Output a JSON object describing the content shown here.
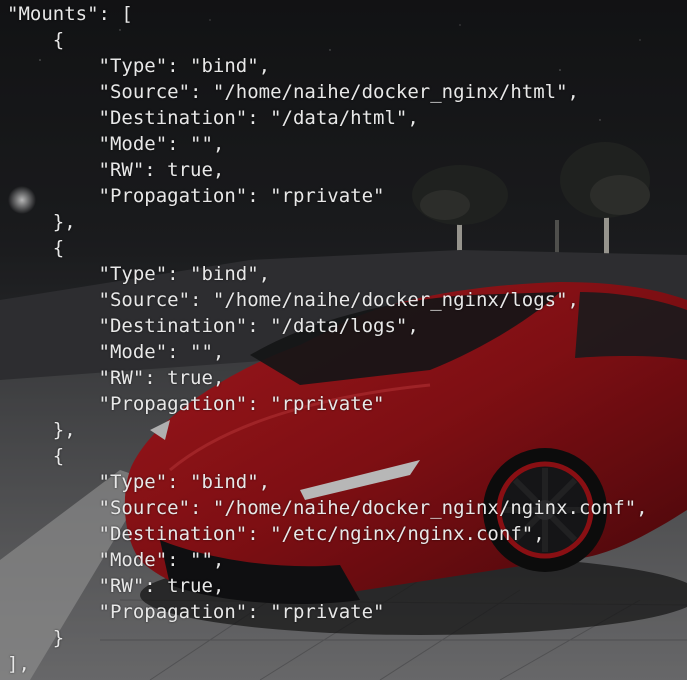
{
  "terminal": {
    "lines": [
      "\"Mounts\": [",
      "    {",
      "        \"Type\": \"bind\",",
      "        \"Source\": \"/home/naihe/docker_nginx/html\",",
      "        \"Destination\": \"/data/html\",",
      "        \"Mode\": \"\",",
      "        \"RW\": true,",
      "        \"Propagation\": \"rprivate\"",
      "    },",
      "    {",
      "        \"Type\": \"bind\",",
      "        \"Source\": \"/home/naihe/docker_nginx/logs\",",
      "        \"Destination\": \"/data/logs\",",
      "        \"Mode\": \"\",",
      "        \"RW\": true,",
      "        \"Propagation\": \"rprivate\"",
      "    },",
      "    {",
      "        \"Type\": \"bind\",",
      "        \"Source\": \"/home/naihe/docker_nginx/nginx.conf\",",
      "        \"Destination\": \"/etc/nginx/nginx.conf\",",
      "        \"Mode\": \"\",",
      "        \"RW\": true,",
      "        \"Propagation\": \"rprivate\"",
      "    }",
      "],"
    ],
    "text_color": "#e8e8e8"
  },
  "wallpaper": {
    "subject": "red-sports-car",
    "car_color": "#b3161c",
    "sky_color": "#151618",
    "ground_color": "#6e6e70"
  }
}
